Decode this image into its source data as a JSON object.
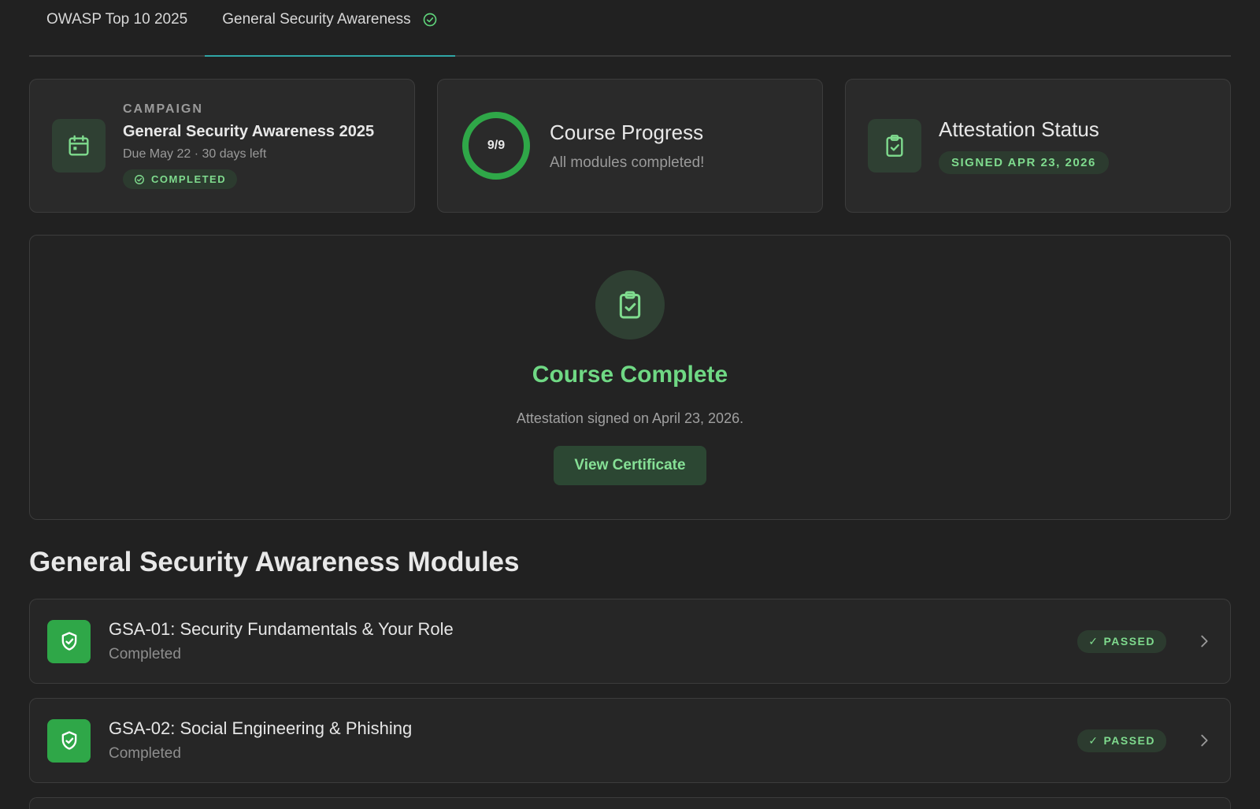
{
  "tabs": [
    {
      "label": "OWASP Top 10 2025",
      "active": false
    },
    {
      "label": "General Security Awareness",
      "active": true,
      "icon": "check-circle-icon"
    }
  ],
  "campaign_card": {
    "eyebrow": "CAMPAIGN",
    "name": "General Security Awareness 2025",
    "due": "Due May 22 · 30 days left",
    "badge": "COMPLETED",
    "icon": "calendar-icon"
  },
  "progress_card": {
    "ring_label": "9/9",
    "completed": 9,
    "total": 9,
    "title": "Course Progress",
    "subtitle": "All modules completed!"
  },
  "attestation_card": {
    "title": "Attestation Status",
    "badge": "SIGNED APR 23, 2026",
    "icon": "clipboard-check-icon"
  },
  "completion_panel": {
    "title": "Course Complete",
    "subtitle": "Attestation signed on April 23, 2026.",
    "button": "View Certificate"
  },
  "section_title": "General Security Awareness Modules",
  "modules": [
    {
      "title": "GSA-01: Security Fundamentals & Your Role",
      "status": "Completed",
      "badge": "PASSED"
    },
    {
      "title": "GSA-02: Social Engineering & Phishing",
      "status": "Completed",
      "badge": "PASSED"
    }
  ],
  "colors": {
    "accent_green": "#6fd884",
    "tab_underline": "#2fa6a6",
    "background": "#212121"
  }
}
